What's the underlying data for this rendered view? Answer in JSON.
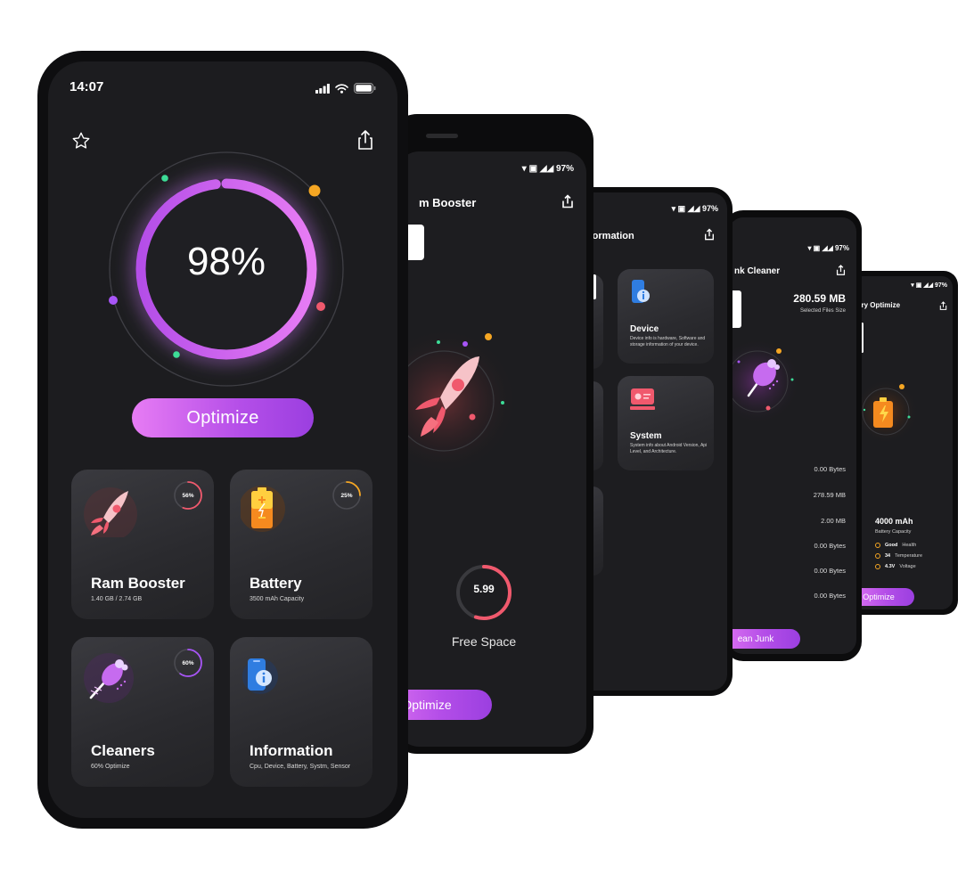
{
  "main": {
    "status": {
      "time": "14:07"
    },
    "gauge": {
      "percent": "98%",
      "level": 0.98
    },
    "optimize_label": "Optimize",
    "cards": [
      {
        "title": "Ram Booster",
        "subtitle": "1.40 GB / 2.74 GB",
        "badge": "56%",
        "progress": 0.56,
        "ring_color": "#f0596d"
      },
      {
        "title": "Battery",
        "subtitle": "3500  mAh Capacity",
        "badge": "25%",
        "progress": 0.25,
        "ring_color": "#f5a623"
      },
      {
        "title": "Cleaners",
        "subtitle": "60%  Optimize",
        "badge": "60%",
        "progress": 0.6,
        "ring_color": "#a855f7"
      },
      {
        "title": "Information",
        "subtitle": "Cpu, Device, Battery, Systm, Sensor"
      }
    ]
  },
  "ram_booster": {
    "battery": "97%",
    "title": "m Booster",
    "free_space_value": "5.99",
    "free_space_label": "Free Space",
    "free_space_progress": 0.55,
    "optimize_label": "Optimize"
  },
  "information": {
    "battery": "97%",
    "title": "formation",
    "device_title": "Device",
    "device_desc": "Device info is hardware, Software and storage information of your device.",
    "system_title": "System",
    "system_desc": "System info about Android Version, Api Level, and Architecture."
  },
  "junk_cleaner": {
    "battery": "97%",
    "title": "nk Cleaner",
    "selected_size": "280.59 MB",
    "selected_label": "Selected Files Size",
    "sizes": [
      "0.00 Bytes",
      "278.59 MB",
      "2.00 MB",
      "0.00 Bytes",
      "0.00 Bytes",
      "0.00 Bytes"
    ],
    "button_label": "ean Junk"
  },
  "battery_optimize": {
    "battery": "97%",
    "title": "ery Optimize",
    "capacity": "4000 mAh",
    "capacity_label": "Battery Capacity",
    "stats": [
      {
        "value": "Good",
        "label": "Health"
      },
      {
        "value": "34",
        "label": "Temperature"
      },
      {
        "value": "4.3V",
        "label": "Voltage"
      }
    ],
    "button_label": "Optimize"
  },
  "colors": {
    "accent_pink": "#e77cf4",
    "accent_purple": "#a855f7",
    "orange": "#f5a623",
    "red": "#f0596d",
    "green": "#3ddc97"
  }
}
